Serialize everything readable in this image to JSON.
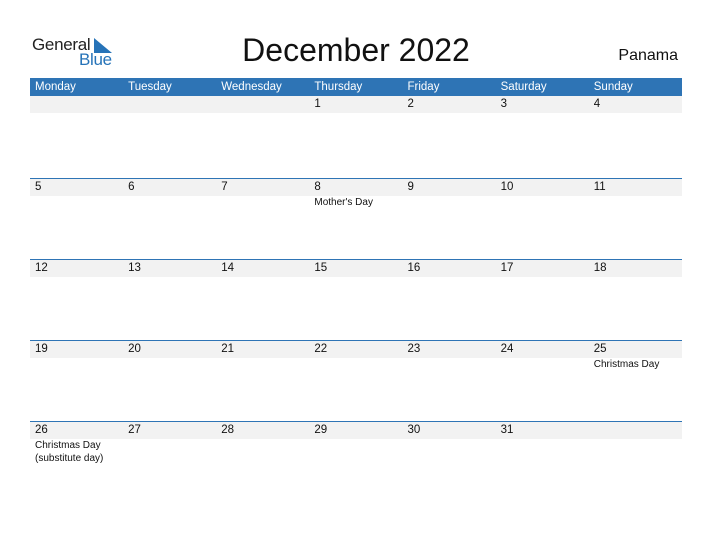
{
  "logo": {
    "general": "General",
    "blue": "Blue"
  },
  "title": "December 2022",
  "country": "Panama",
  "colors": {
    "accent": "#2e74b5",
    "band": "#f2f2f2"
  },
  "weekdays": [
    "Monday",
    "Tuesday",
    "Wednesday",
    "Thursday",
    "Friday",
    "Saturday",
    "Sunday"
  ],
  "weeks": [
    {
      "days": [
        "",
        "",
        "",
        "1",
        "2",
        "3",
        "4"
      ],
      "events": [
        "",
        "",
        "",
        "",
        "",
        "",
        ""
      ]
    },
    {
      "days": [
        "5",
        "6",
        "7",
        "8",
        "9",
        "10",
        "11"
      ],
      "events": [
        "",
        "",
        "",
        "Mother's Day",
        "",
        "",
        ""
      ]
    },
    {
      "days": [
        "12",
        "13",
        "14",
        "15",
        "16",
        "17",
        "18"
      ],
      "events": [
        "",
        "",
        "",
        "",
        "",
        "",
        ""
      ]
    },
    {
      "days": [
        "19",
        "20",
        "21",
        "22",
        "23",
        "24",
        "25"
      ],
      "events": [
        "",
        "",
        "",
        "",
        "",
        "",
        "Christmas Day"
      ]
    },
    {
      "days": [
        "26",
        "27",
        "28",
        "29",
        "30",
        "31",
        ""
      ],
      "events": [
        "Christmas Day (substitute day)",
        "",
        "",
        "",
        "",
        "",
        ""
      ]
    }
  ]
}
